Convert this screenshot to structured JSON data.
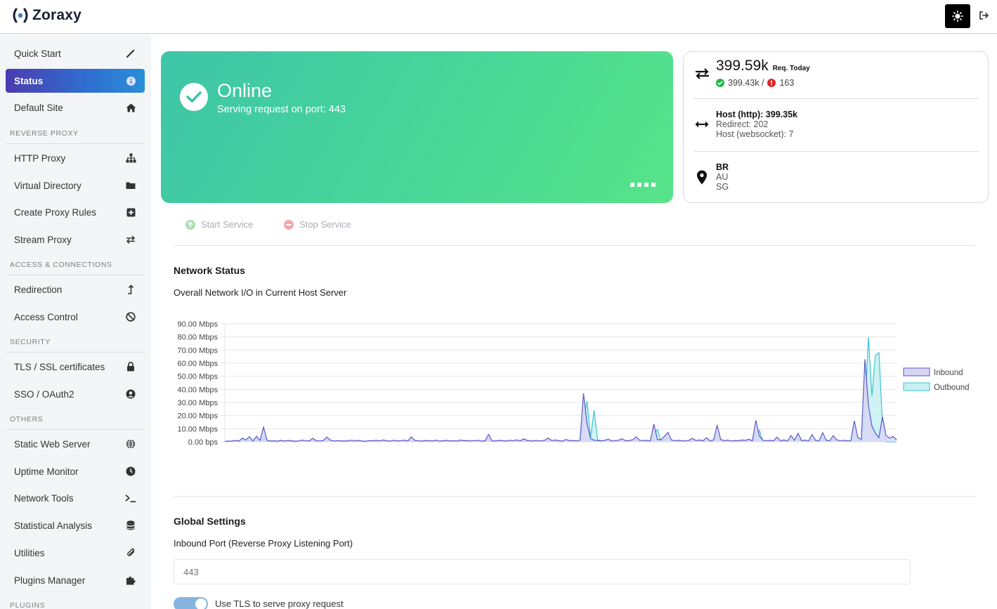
{
  "app": {
    "title": "Zoraxy"
  },
  "sidebar": {
    "items": [
      {
        "label": "Quick Start",
        "icon": "magic-wand-icon"
      },
      {
        "label": "Status",
        "icon": "info-icon"
      },
      {
        "label": "Default Site",
        "icon": "home-icon"
      },
      {
        "label": "HTTP Proxy",
        "icon": "sitemap-icon"
      },
      {
        "label": "Virtual Directory",
        "icon": "folder-icon"
      },
      {
        "label": "Create Proxy Rules",
        "icon": "plus-square-icon"
      },
      {
        "label": "Stream Proxy",
        "icon": "exchange-icon"
      },
      {
        "label": "Redirection",
        "icon": "level-up-icon"
      },
      {
        "label": "Access Control",
        "icon": "ban-icon"
      },
      {
        "label": "TLS / SSL certificates",
        "icon": "lock-icon"
      },
      {
        "label": "SSO / OAuth2",
        "icon": "user-circle-icon"
      },
      {
        "label": "Static Web Server",
        "icon": "globe-icon"
      },
      {
        "label": "Uptime Monitor",
        "icon": "clock-icon"
      },
      {
        "label": "Network Tools",
        "icon": "terminal-icon"
      },
      {
        "label": "Statistical Analysis",
        "icon": "database-icon"
      },
      {
        "label": "Utilities",
        "icon": "paperclip-icon"
      },
      {
        "label": "Plugins Manager",
        "icon": "puzzle-icon"
      }
    ],
    "sections": {
      "reverse_proxy": "REVERSE PROXY",
      "access": "ACCESS & CONNECTIONS",
      "security": "SECURITY",
      "others": "OTHERS",
      "plugins": "PLUGINS"
    }
  },
  "status": {
    "title": "Online",
    "subtitle": "Serving request on port: 443"
  },
  "stats": {
    "requests_today": "399.59k",
    "requests_label": "Req. Today",
    "success": "399.43k /",
    "errors": "163",
    "host_http": "Host (http): 399.35k",
    "redirect": "Redirect: 202",
    "host_websocket": "Host (websocket): 7",
    "countries": [
      "BR",
      "AU",
      "SG"
    ]
  },
  "service": {
    "start_label": "Start Service",
    "stop_label": "Stop Service"
  },
  "network": {
    "heading": "Network Status",
    "description": "Overall Network I/O in Current Host Server"
  },
  "chart_data": {
    "type": "area",
    "ylim": [
      0,
      90
    ],
    "y_ticks": [
      "90.00 Mbps",
      "80.00 Mbps",
      "70.00 Mbps",
      "60.00 Mbps",
      "50.00 Mbps",
      "40.00 Mbps",
      "30.00 Mbps",
      "20.00 Mbps",
      "10.00 Mbps",
      "0.00 bps"
    ],
    "legend_position": "right",
    "grid": true,
    "series": [
      {
        "name": "Inbound",
        "color": "#5b57c9",
        "fill": "#d8d7f3",
        "values": [
          0.4,
          0.6,
          0.5,
          1.1,
          0.6,
          2.8,
          1.5,
          3.9,
          0.7,
          4.2,
          1.2,
          11.2,
          1.1,
          0.6,
          0.8,
          0.5,
          1.2,
          0.6,
          1.0,
          0.8,
          0.5,
          0.7,
          1.3,
          0.9,
          0.6,
          2.7,
          0.9,
          0.7,
          1.0,
          3.6,
          1.3,
          0.6,
          0.9,
          0.8,
          0.6,
          0.8,
          1.2,
          0.7,
          1.1,
          0.6,
          0.5,
          0.9,
          0.8,
          1.1,
          0.7,
          1.4,
          0.8,
          0.6,
          1.2,
          0.7,
          0.9,
          1.3,
          0.6,
          3.8,
          1.2,
          0.8,
          0.6,
          1.0,
          0.9,
          0.7,
          1.3,
          0.6,
          0.8,
          1.1,
          0.7,
          0.9,
          0.6,
          1.4,
          0.8,
          1.0,
          0.7,
          0.9,
          1.2,
          0.6,
          0.8,
          5.6,
          0.8,
          0.7,
          1.1,
          0.9,
          0.6,
          1.2,
          0.8,
          1.5,
          0.7,
          2.3,
          1.1,
          0.6,
          1.0,
          0.9,
          0.7,
          1.3,
          2.9,
          0.9,
          1.4,
          0.8,
          0.6,
          1.8,
          0.9,
          1.0,
          0.7,
          1.2,
          37.0,
          14.0,
          2.5,
          1.2,
          0.9,
          0.8,
          1.1,
          2.1,
          0.7,
          0.9,
          1.3,
          2.4,
          0.8,
          1.0,
          1.6,
          3.8,
          1.2,
          0.9,
          1.1,
          0.8,
          13.5,
          1.8,
          1.5,
          4.1,
          7.2,
          1.4,
          0.9,
          1.1,
          0.8,
          0.7,
          1.2,
          2.6,
          0.9,
          1.4,
          0.8,
          3.1,
          0.7,
          1.5,
          12.8,
          1.8,
          0.9,
          1.3,
          0.7,
          1.0,
          0.8,
          1.4,
          1.1,
          2.0,
          0.8,
          16.5,
          4.3,
          1.2,
          0.9,
          1.1,
          0.8,
          3.6,
          0.9,
          1.4,
          0.7,
          4.8,
          1.2,
          6.5,
          0.9,
          1.3,
          0.8,
          5.5,
          1.1,
          0.9,
          7.0,
          1.3,
          0.8,
          4.6,
          1.5,
          0.9,
          1.2,
          0.8,
          0.9,
          16.0,
          3.4,
          1.8,
          63.0,
          28.0,
          12.0,
          6.5,
          3.2,
          19.0,
          5.0,
          2.8,
          4.1,
          1.5
        ],
        "source": "approximate"
      },
      {
        "name": "Outbound",
        "color": "#3cc6cf",
        "fill": "#c8f0f2",
        "values": [
          0.2,
          0.3,
          0.3,
          0.6,
          0.3,
          1.2,
          0.7,
          1.6,
          0.3,
          1.8,
          0.5,
          4.0,
          0.5,
          0.3,
          0.4,
          0.2,
          0.5,
          0.3,
          0.5,
          0.4,
          0.2,
          0.3,
          0.6,
          0.4,
          0.3,
          1.0,
          0.4,
          0.3,
          0.5,
          1.5,
          0.6,
          0.3,
          0.4,
          0.4,
          0.3,
          0.4,
          0.5,
          0.3,
          0.5,
          0.3,
          0.2,
          0.4,
          0.4,
          0.5,
          0.3,
          0.6,
          0.4,
          0.3,
          0.5,
          0.3,
          0.4,
          0.6,
          0.3,
          1.6,
          0.5,
          0.4,
          0.3,
          0.5,
          0.4,
          0.3,
          0.6,
          0.3,
          0.4,
          0.5,
          0.3,
          0.4,
          0.3,
          0.6,
          0.4,
          0.5,
          0.3,
          0.4,
          0.5,
          0.3,
          0.4,
          2.3,
          0.4,
          0.3,
          0.5,
          0.4,
          0.3,
          0.5,
          0.4,
          0.7,
          0.3,
          1.0,
          0.5,
          0.3,
          0.5,
          0.4,
          0.3,
          0.6,
          1.2,
          0.4,
          0.6,
          0.4,
          0.3,
          0.8,
          0.4,
          0.5,
          0.3,
          0.5,
          18.0,
          31.0,
          3.1,
          24.0,
          1.5,
          0.8,
          0.9,
          1.0,
          0.4,
          0.5,
          0.6,
          1.0,
          0.4,
          0.5,
          0.7,
          1.6,
          0.5,
          0.4,
          0.5,
          0.4,
          6.0,
          9.5,
          0.8,
          1.7,
          3.2,
          0.6,
          0.4,
          0.5,
          0.4,
          0.3,
          0.5,
          1.1,
          0.4,
          0.6,
          0.4,
          1.3,
          0.3,
          0.7,
          5.5,
          0.8,
          0.4,
          0.6,
          0.3,
          0.5,
          0.4,
          0.6,
          0.5,
          0.9,
          0.4,
          7.0,
          9.0,
          0.6,
          0.4,
          0.5,
          0.4,
          1.5,
          0.4,
          0.6,
          0.3,
          2.0,
          0.5,
          2.7,
          0.4,
          0.6,
          0.4,
          2.3,
          0.5,
          0.4,
          3.0,
          0.6,
          0.4,
          2.0,
          0.7,
          0.4,
          0.5,
          0.4,
          0.4,
          7.0,
          1.5,
          0.8,
          25.0,
          80.0,
          35.0,
          66.0,
          68.0,
          14.0,
          0,
          0,
          0,
          0
        ],
        "source": "approximate"
      }
    ]
  },
  "global": {
    "heading": "Global Settings",
    "port_label": "Inbound Port (Reverse Proxy Listening Port)",
    "port_value": "443",
    "tls_label": "Use TLS to serve proxy request"
  }
}
